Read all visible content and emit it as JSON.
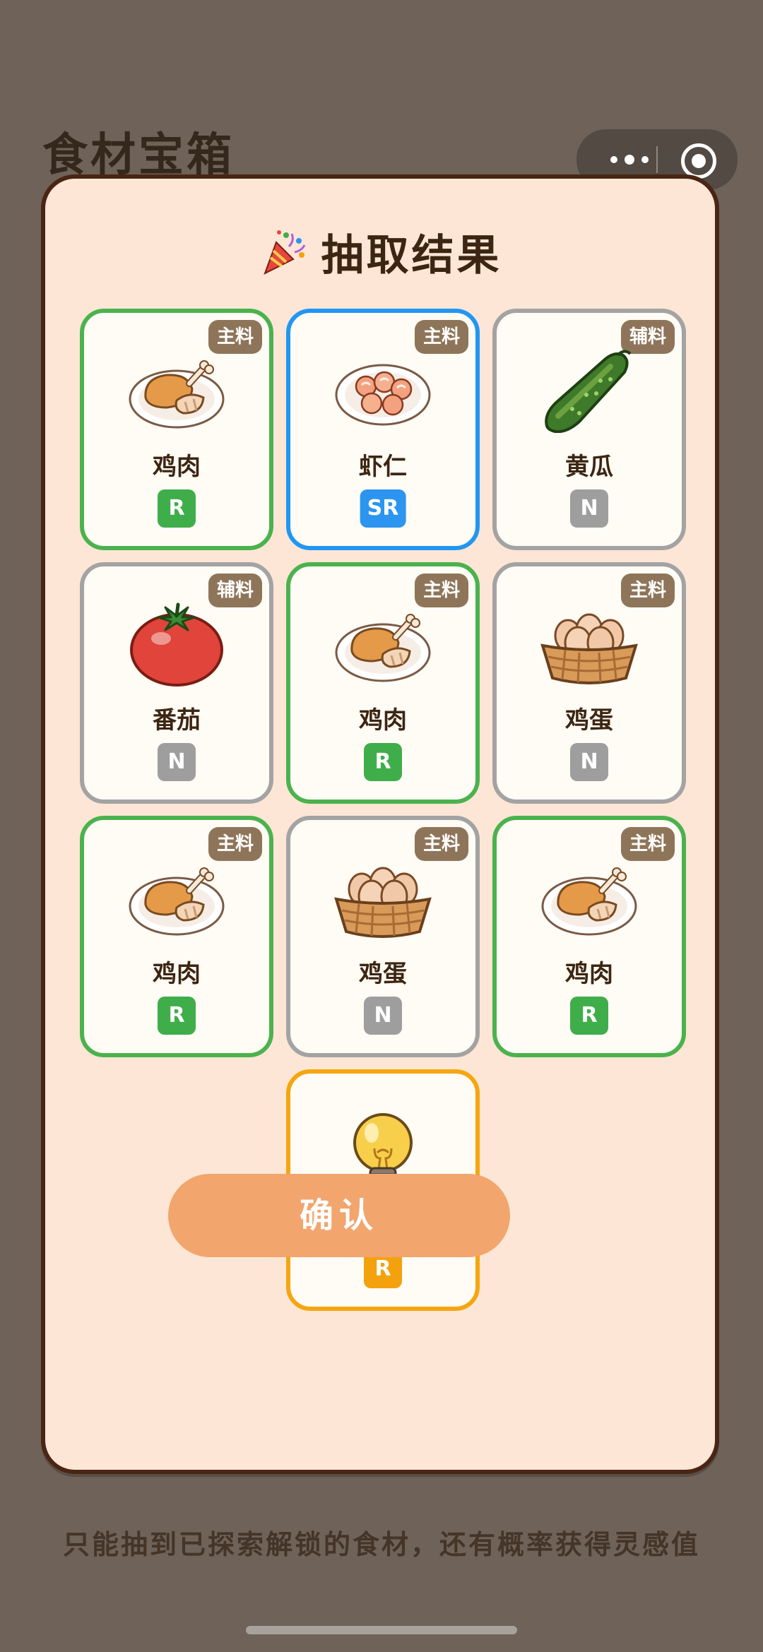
{
  "page": {
    "title": "食材宝箱",
    "hint": "只能抽到已探索解锁的食材，还有概率获得灵感值"
  },
  "modal": {
    "title": "抽取结果",
    "confirm_label": "确认"
  },
  "colors": {
    "R": "#3fae4a",
    "SR": "#2b95f0",
    "N": "#9e9e9e",
    "inspiration": "#f3a20d",
    "confirm": "#f2a56d"
  },
  "results": [
    {
      "name": "鸡肉",
      "tag": "主料",
      "rarity": "R",
      "icon": "chicken-plate-icon"
    },
    {
      "name": "虾仁",
      "tag": "主料",
      "rarity": "SR",
      "icon": "shrimp-plate-icon"
    },
    {
      "name": "黄瓜",
      "tag": "辅料",
      "rarity": "N",
      "icon": "cucumber-icon"
    },
    {
      "name": "番茄",
      "tag": "辅料",
      "rarity": "N",
      "icon": "tomato-icon"
    },
    {
      "name": "鸡肉",
      "tag": "主料",
      "rarity": "R",
      "icon": "chicken-plate-icon"
    },
    {
      "name": "鸡蛋",
      "tag": "主料",
      "rarity": "N",
      "icon": "egg-basket-icon"
    },
    {
      "name": "鸡肉",
      "tag": "主料",
      "rarity": "R",
      "icon": "chicken-plate-icon"
    },
    {
      "name": "鸡蛋",
      "tag": "主料",
      "rarity": "N",
      "icon": "egg-basket-icon"
    },
    {
      "name": "鸡肉",
      "tag": "主料",
      "rarity": "R",
      "icon": "chicken-plate-icon"
    },
    {
      "name": "灵感 +1",
      "rarity": "R",
      "icon": "lightbulb-icon"
    }
  ]
}
